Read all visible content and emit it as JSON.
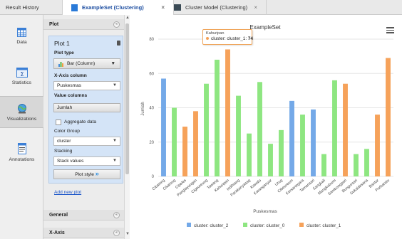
{
  "tabs": {
    "results": "Result History",
    "active": "ExampleSet (Clustering)",
    "model": "Cluster Model (Clustering)",
    "close_symbol": "×"
  },
  "views": [
    {
      "label": "Data",
      "icon": "table-icon"
    },
    {
      "label": "Statistics",
      "icon": "statistics-icon"
    },
    {
      "label": "Visualizations",
      "icon": "globe-chart-icon"
    },
    {
      "label": "Annotations",
      "icon": "annotations-icon"
    }
  ],
  "panel": {
    "header": "Plot",
    "plot_name": "Plot 1",
    "plot_type_label": "Plot type",
    "plot_type_value": "Bar (Column)",
    "x_axis_label": "X-Axis column",
    "x_axis_value": "Puskesmas",
    "value_columns_label": "Value columns",
    "value_column": "Jumlah",
    "aggregate_label": "Aggregate data",
    "color_group_label": "Color Group",
    "color_group_value": "cluster",
    "stacking_label": "Stacking",
    "stacking_value": "Stack values",
    "plot_style_label": "Plot style",
    "plot_style_arrows": "»",
    "add_plot_link": "Add new plot",
    "general_header": "General",
    "x_axis_header": "X-Axis",
    "collapse_symbol": "«",
    "dropdown_caret": "▼"
  },
  "tooltip": {
    "title": "Kahuripan",
    "series": "cluster: cluster_1",
    "value": "74"
  },
  "colors": {
    "cluster_2": "#74a9e8",
    "cluster_0": "#8ee681",
    "cluster_1": "#f6a25a"
  },
  "chart_data": {
    "type": "bar",
    "title": "ExampleSet",
    "xlabel": "Puskesmas",
    "ylabel": "Jumlah",
    "ylim": [
      0,
      80
    ],
    "yticks": [
      0,
      20,
      40,
      60,
      80
    ],
    "grid": true,
    "legend_position": "bottom",
    "categories": [
      "Cibalong",
      "Cikalong",
      "Cipeles",
      "Panglayungan",
      "Cigeureung",
      "Tawang",
      "Kahuripan",
      "Indihiang",
      "Parakanyasag",
      "Kawalu",
      "Karanganyar",
      "Urug",
      "Cibeureum",
      "Kersanegara",
      "Tamansari",
      "Sangkali",
      "Mangkubumi",
      "Sambongpari",
      "Bungursari",
      "Sukalaksana",
      "Bantar",
      "Purbaratu"
    ],
    "series": [
      {
        "name": "cluster: cluster_2",
        "values": [
          57,
          null,
          null,
          null,
          null,
          null,
          null,
          null,
          null,
          null,
          null,
          null,
          44,
          null,
          39,
          null,
          null,
          null,
          null,
          null,
          null,
          null
        ]
      },
      {
        "name": "cluster: cluster_0",
        "values": [
          null,
          40,
          null,
          null,
          54,
          68,
          null,
          47,
          25,
          55,
          19,
          27,
          null,
          36,
          null,
          13,
          56,
          null,
          13,
          16,
          null,
          null
        ]
      },
      {
        "name": "cluster: cluster_1",
        "values": [
          null,
          null,
          29,
          38,
          null,
          null,
          74,
          null,
          null,
          null,
          null,
          null,
          null,
          null,
          null,
          null,
          null,
          54,
          null,
          null,
          36,
          69
        ]
      }
    ]
  }
}
